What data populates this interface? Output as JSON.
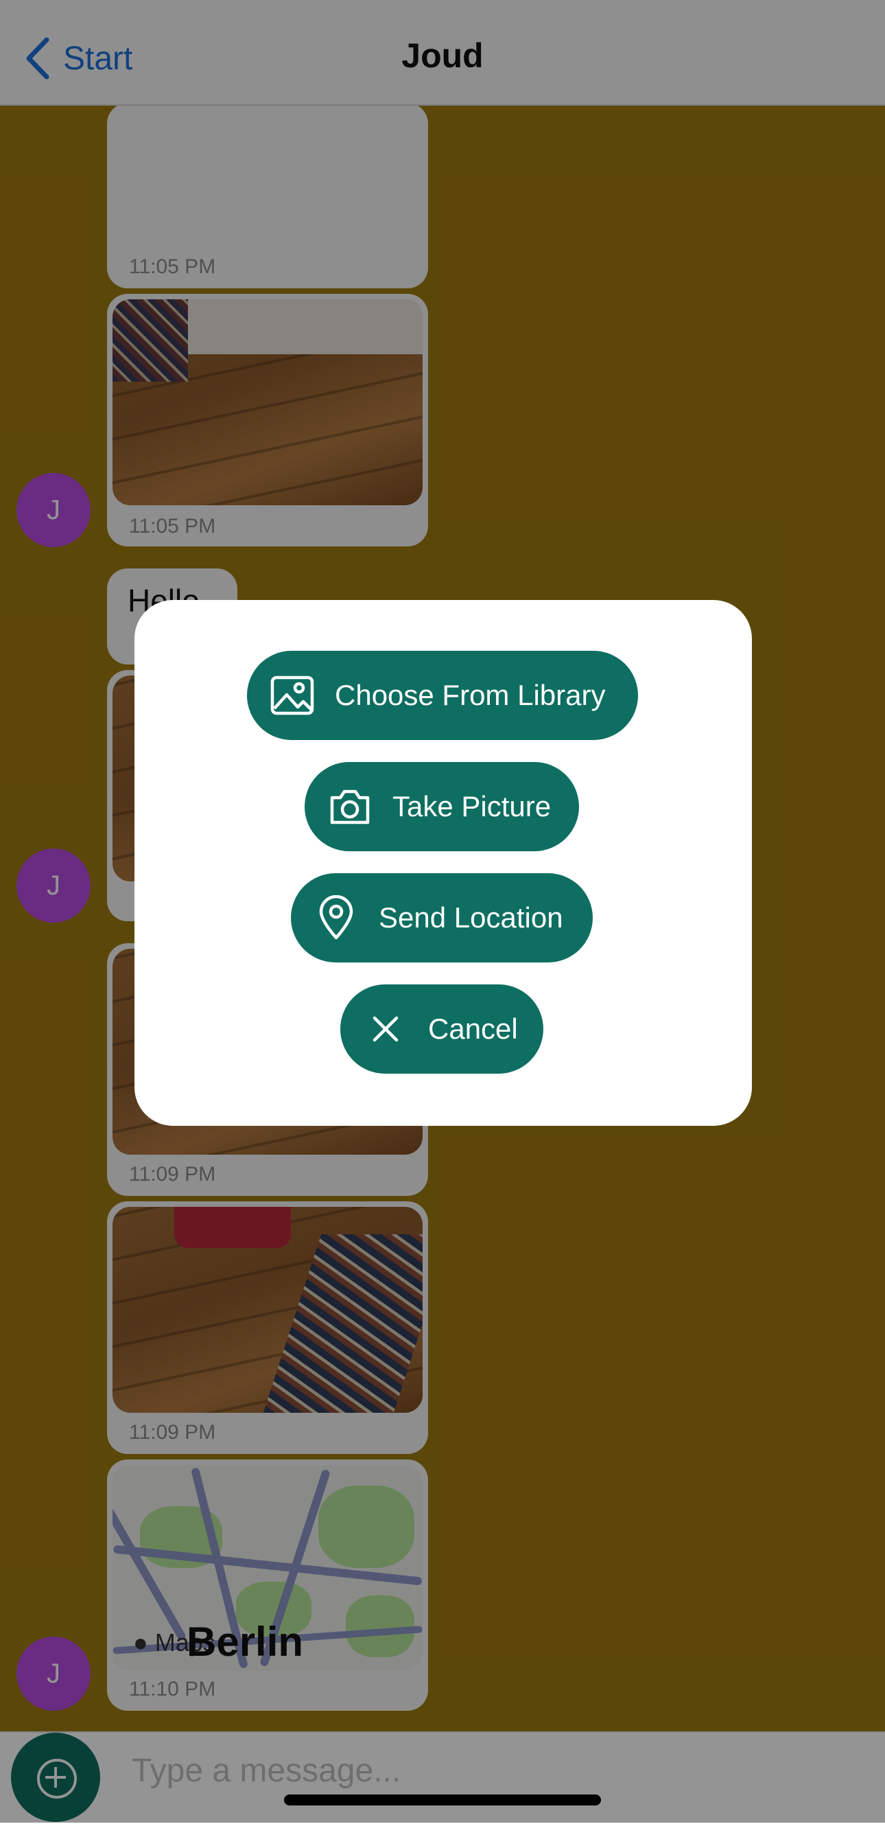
{
  "nav": {
    "back_label": "Start",
    "title": "Joud"
  },
  "messages": [
    {
      "timestamp": "11:05 PM"
    },
    {
      "timestamp": "11:05 PM"
    },
    {
      "text": "Hello"
    },
    {
      "timestamp": "11:09 PM"
    },
    {
      "timestamp": "11:09 PM"
    },
    {
      "timestamp": "11:10 PM",
      "map_attribution": "Maps",
      "map_city": "Berlin"
    }
  ],
  "avatar": {
    "initial": "J",
    "color": "#b64de0"
  },
  "composer": {
    "placeholder": "Type a message..."
  },
  "action_sheet": {
    "library_label": "Choose From Library",
    "camera_label": "Take Picture",
    "location_label": "Send Location",
    "cancel_label": "Cancel"
  },
  "colors": {
    "accent": "#0e6e61",
    "chat_background": "#9e7a0d",
    "link": "#1e6fd9"
  }
}
